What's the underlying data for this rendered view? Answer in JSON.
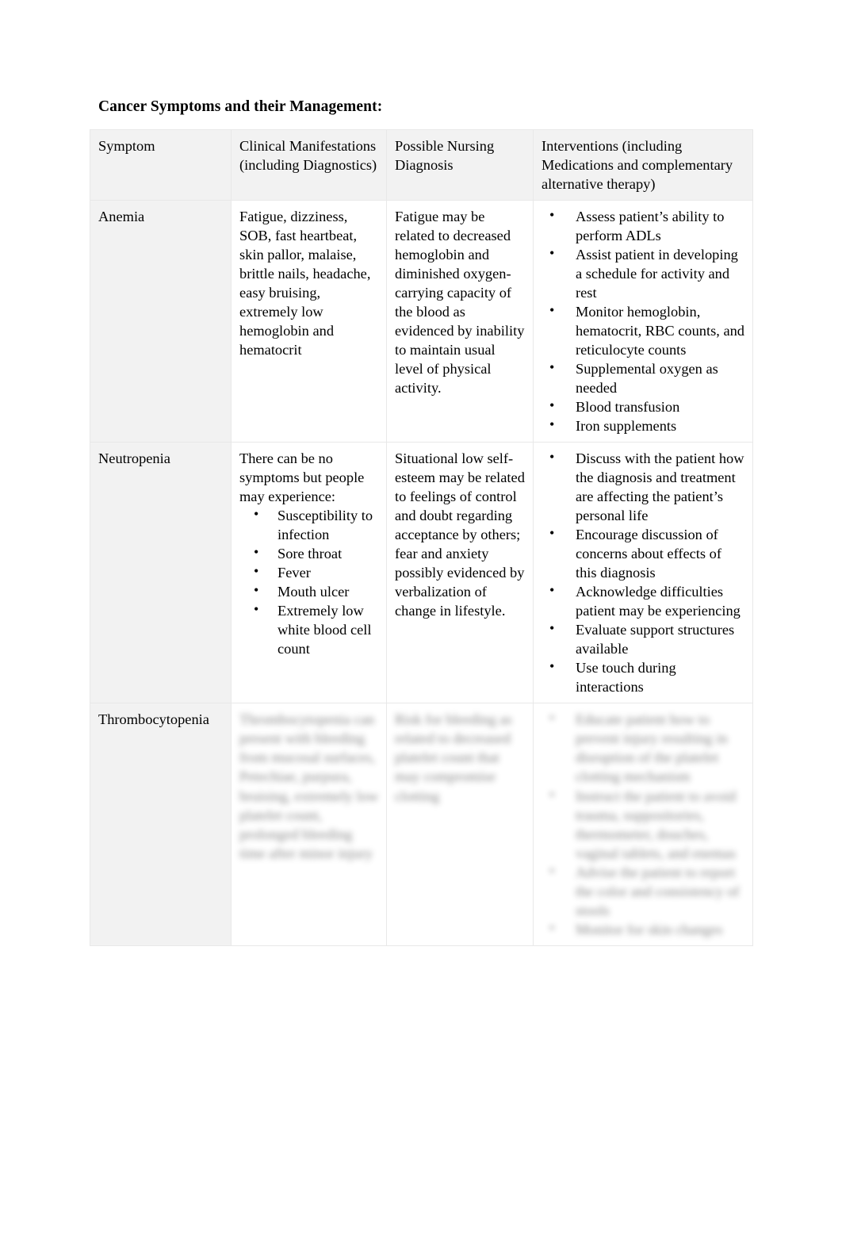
{
  "document": {
    "title": "Cancer Symptoms and their Management:"
  },
  "table": {
    "headers": {
      "symptom": "Symptom",
      "manifestations": "Clinical Manifestations (including Diagnostics)",
      "diagnosis": "Possible Nursing Diagnosis",
      "interventions": "Interventions (including Medications and complementary alternative therapy)"
    },
    "rows": [
      {
        "symptom": "Anemia",
        "manifestations_text": "Fatigue, dizziness, SOB, fast heartbeat, skin pallor, malaise, brittle nails, headache, easy bruising, extremely low hemoglobin and hematocrit",
        "manifestations_bullets": [],
        "diagnosis": "Fatigue may be related to decreased hemoglobin and diminished oxygen-carrying capacity of the blood as evidenced by inability to maintain usual level of physical activity.",
        "interventions": [
          "Assess patient’s ability to perform ADLs",
          "Assist patient in developing a schedule for activity and rest",
          "Monitor hemoglobin, hematocrit, RBC counts, and reticulocyte counts",
          "Supplemental oxygen as needed",
          "Blood transfusion",
          "Iron supplements"
        ],
        "blurred": false
      },
      {
        "symptom": "Neutropenia",
        "manifestations_text": "There can be no symptoms but people may experience:",
        "manifestations_bullets": [
          "Susceptibility to infection",
          "Sore throat",
          "Fever",
          "Mouth ulcer",
          "Extremely low white blood cell count"
        ],
        "diagnosis": "Situational low self-esteem may be related to feelings of control and doubt regarding acceptance by others; fear and anxiety possibly evidenced by verbalization of change in lifestyle.",
        "interventions": [
          "Discuss with the patient how the diagnosis and treatment are affecting the patient’s personal life",
          "Encourage discussion of concerns about effects of this diagnosis",
          "Acknowledge difficulties patient may be experiencing",
          "Evaluate support structures available",
          "Use touch during interactions"
        ],
        "blurred": false
      },
      {
        "symptom": "Thrombocytopenia",
        "manifestations_text": "Thrombocytopenia can present with bleeding from mucosal surfaces, Petechiae, purpura, bruising, extremely low platelet count, prolonged bleeding time after minor injury",
        "manifestations_bullets": [],
        "diagnosis": "Risk for bleeding as related to decreased platelet count that may compromise clotting",
        "interventions": [
          "Educate patient how to prevent injury resulting in disruption of the platelet clotting mechanism",
          "Instruct the patient to avoid trauma, suppositories, thermometer, douches, vaginal tablets, and enemas",
          "Advise the patient to report the color and consistency of stools",
          "Monitor for skin changes"
        ],
        "blurred": true
      }
    ]
  }
}
